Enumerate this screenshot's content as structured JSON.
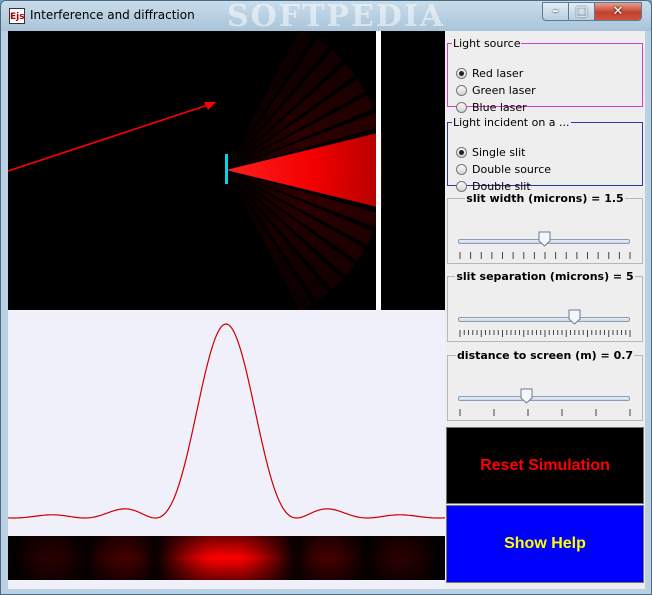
{
  "window": {
    "title": "Interference and diffraction",
    "icon_text": "Ejs",
    "watermark": "SOFTPEDIA",
    "controls": {
      "minimize": "–",
      "maximize": "□",
      "close": "✕"
    }
  },
  "light_source": {
    "legend": "Light source",
    "options": [
      "Red laser",
      "Green laser",
      "Blue laser"
    ],
    "selected_index": 0,
    "border_color": "#d43fc6"
  },
  "incident": {
    "legend": "Light incident on a ...",
    "options": [
      "Single slit",
      "Double source",
      "Double slit"
    ],
    "selected_index": 0,
    "border_color": "#2c3aa0"
  },
  "sliders": [
    {
      "label": "slit width (microns) = 1.5",
      "position_fraction": 0.5,
      "tick_count": 17
    },
    {
      "label": "slit separation (microns) = 5",
      "position_fraction": 0.675,
      "tick_count": 41
    },
    {
      "label": "distance to screen (m) = 0.7",
      "position_fraction": 0.4,
      "tick_count": 6
    }
  ],
  "buttons": {
    "reset": {
      "label": "Reset Simulation",
      "bg": "#000000",
      "fg": "#ff0000"
    },
    "help": {
      "label": "Show Help",
      "bg": "#0000ff",
      "fg": "#ffff00"
    }
  },
  "colors": {
    "laser": "#ff0000",
    "slit": "#00d8e8",
    "screen": "#ffffff",
    "plot_bg": "#f0f0fa",
    "curve": "#cc0000"
  }
}
